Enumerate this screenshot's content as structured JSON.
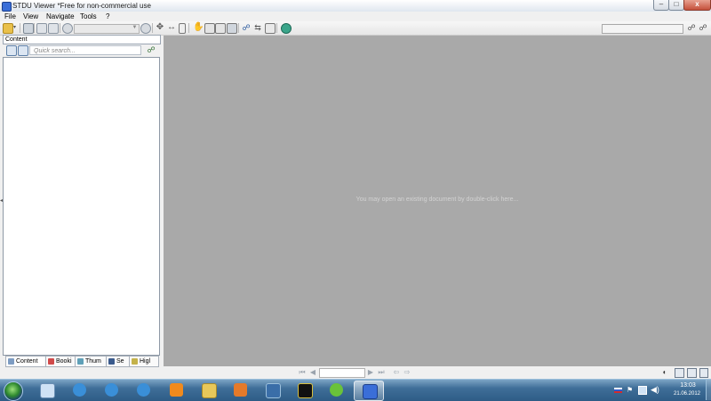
{
  "window": {
    "title": "STDU Viewer *Free for non-commercial use",
    "controls": {
      "minimize": "–",
      "maximize": "□",
      "close": "x"
    }
  },
  "menu": {
    "file": "File",
    "view": "View",
    "navigate": "Navigate",
    "tools": "Tools",
    "help": "?"
  },
  "left_panel": {
    "header": "Content",
    "search_placeholder": "Quick search...",
    "tabs": [
      "Content",
      "Booki",
      "Thum",
      "Se",
      "Higl"
    ]
  },
  "document": {
    "hint": "You may open an existing document by double-click here..."
  },
  "taskbar": {
    "time": "13:03",
    "date": "21.06.2012"
  },
  "colors": {
    "doc_bg": "#a9a9a9",
    "taskbar": "#3f6e98",
    "accent": "#3a6ed8"
  }
}
